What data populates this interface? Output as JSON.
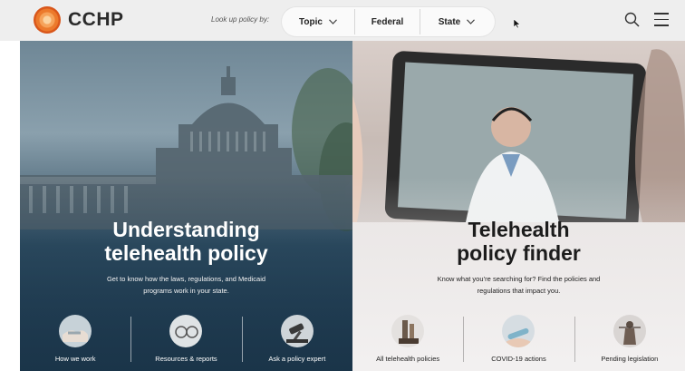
{
  "header": {
    "brand": "CCHP",
    "lookup_label": "Look up policy by:",
    "filters": [
      {
        "label": "Topic",
        "has_dropdown": true
      },
      {
        "label": "Federal",
        "has_dropdown": false
      },
      {
        "label": "State",
        "has_dropdown": true
      }
    ],
    "icons": [
      "search-icon",
      "menu-icon"
    ]
  },
  "panels": {
    "left": {
      "title_line1": "Understanding",
      "title_line2": "telehealth policy",
      "desc_line1": "Get to know how the laws, regulations, and Medicaid",
      "desc_line2": "programs work in your state.",
      "links": [
        {
          "label": "How we work"
        },
        {
          "label": "Resources & reports"
        },
        {
          "label": "Ask a policy expert"
        }
      ]
    },
    "right": {
      "title_line1": "Telehealth",
      "title_line2": "policy finder",
      "desc_line1": "Know what you’re searching for? Find the policies and",
      "desc_line2": "regulations that impact you.",
      "links": [
        {
          "label": "All telehealth policies"
        },
        {
          "label": "COVID-19 actions"
        },
        {
          "label": "Pending legislation"
        }
      ]
    }
  },
  "colors": {
    "brand_orange": "#ec7a2c",
    "header_bg": "#eeeeee",
    "left_panel_dark": "#1e3a50"
  }
}
